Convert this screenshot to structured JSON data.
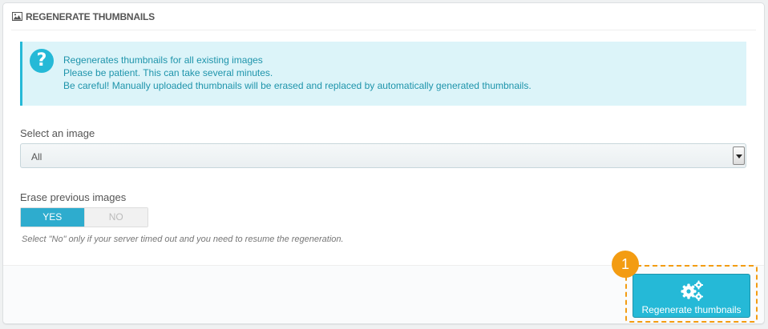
{
  "panel": {
    "title": "REGENERATE THUMBNAILS",
    "heading_icon": "image-icon"
  },
  "alert": {
    "icon": "question-circle-icon",
    "icon_glyph": "?",
    "lines": [
      "Regenerates thumbnails for all existing images",
      "Please be patient. This can take several minutes.",
      "Be careful! Manually uploaded thumbnails will be erased and replaced by automatically generated thumbnails."
    ]
  },
  "form": {
    "select_label": "Select an image",
    "select_value": "All",
    "erase_label": "Erase previous images",
    "erase_yes": "YES",
    "erase_no": "NO",
    "erase_selected": "YES",
    "erase_hint": "Select \"No\" only if your server timed out and you need to resume the regeneration."
  },
  "footer": {
    "step_number": "1",
    "regenerate_label": "Regenerate thumbnails",
    "regenerate_icon": "gears-icon"
  },
  "colors": {
    "accent": "#25b9d7",
    "info_bg": "#dcf4f9",
    "highlight": "#f39c12"
  }
}
